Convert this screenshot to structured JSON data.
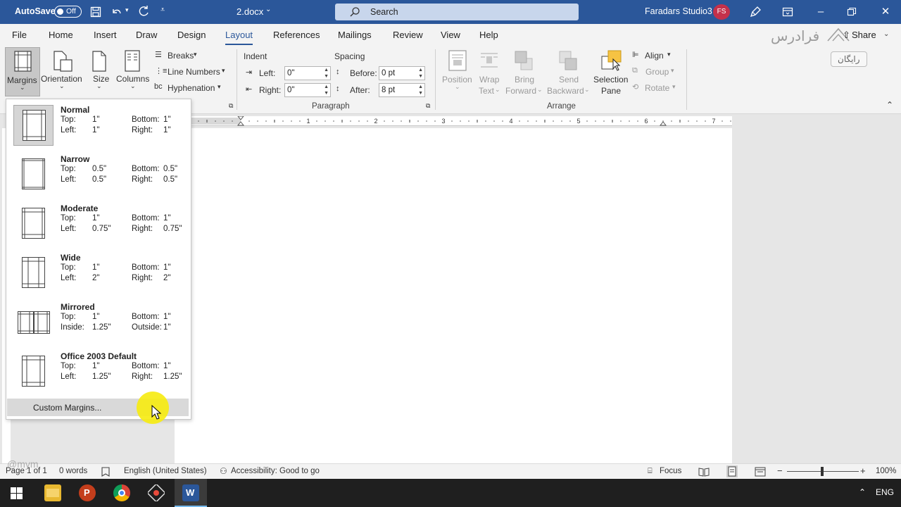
{
  "titlebar": {
    "autosave_label": "AutoSave",
    "autosave_state": "Off",
    "doc_name": "2.docx",
    "search_placeholder": "Search",
    "user_name": "Faradars Studio3",
    "user_initials": "FS",
    "brand_color": "#2b579a"
  },
  "tabs": [
    "File",
    "Home",
    "Insert",
    "Draw",
    "Design",
    "Layout",
    "References",
    "Mailings",
    "Review",
    "View",
    "Help"
  ],
  "active_tab": "Layout",
  "share_label": "Share",
  "watermark": {
    "logo_text": "فرادرس",
    "badge_text": "رایگان",
    "corner_text": "@mym"
  },
  "ribbon": {
    "page_setup": {
      "margins": "Margins",
      "orientation": "Orientation",
      "size": "Size",
      "columns": "Columns",
      "breaks": "Breaks",
      "line_numbers": "Line Numbers",
      "hyphenation": "Hyphenation"
    },
    "paragraph": {
      "group_label": "Paragraph",
      "indent_label": "Indent",
      "spacing_label": "Spacing",
      "left_label": "Left:",
      "left_value": "0\"",
      "right_label": "Right:",
      "right_value": "0\"",
      "before_label": "Before:",
      "before_value": "0 pt",
      "after_label": "After:",
      "after_value": "8 pt"
    },
    "arrange": {
      "group_label": "Arrange",
      "position": "Position",
      "wrap1": "Wrap",
      "wrap2": "Text",
      "bring1": "Bring",
      "bring2": "Forward",
      "send1": "Send",
      "send2": "Backward",
      "selection1": "Selection",
      "selection2": "Pane",
      "align": "Align",
      "group": "Group",
      "rotate": "Rotate"
    }
  },
  "ruler_numbers": [
    "1",
    "2",
    "3",
    "4",
    "5",
    "6",
    "7"
  ],
  "margins_menu": {
    "options": [
      {
        "name": "Normal",
        "a_label": "Top:",
        "a_value": "1\"",
        "b_label": "Bottom:",
        "b_value": "1\"",
        "c_label": "Left:",
        "c_value": "1\"",
        "d_label": "Right:",
        "d_value": "1\"",
        "selected": true
      },
      {
        "name": "Narrow",
        "a_label": "Top:",
        "a_value": "0.5\"",
        "b_label": "Bottom:",
        "b_value": "0.5\"",
        "c_label": "Left:",
        "c_value": "0.5\"",
        "d_label": "Right:",
        "d_value": "0.5\"",
        "selected": false
      },
      {
        "name": "Moderate",
        "a_label": "Top:",
        "a_value": "1\"",
        "b_label": "Bottom:",
        "b_value": "1\"",
        "c_label": "Left:",
        "c_value": "0.75\"",
        "d_label": "Right:",
        "d_value": "0.75\"",
        "selected": false
      },
      {
        "name": "Wide",
        "a_label": "Top:",
        "a_value": "1\"",
        "b_label": "Bottom:",
        "b_value": "1\"",
        "c_label": "Left:",
        "c_value": "2\"",
        "d_label": "Right:",
        "d_value": "2\"",
        "selected": false
      },
      {
        "name": "Mirrored",
        "a_label": "Top:",
        "a_value": "1\"",
        "b_label": "Bottom:",
        "b_value": "1\"",
        "c_label": "Inside:",
        "c_value": "1.25\"",
        "d_label": "Outside:",
        "d_value": "1\"",
        "selected": false
      },
      {
        "name": "Office 2003 Default",
        "a_label": "Top:",
        "a_value": "1\"",
        "b_label": "Bottom:",
        "b_value": "1\"",
        "c_label": "Left:",
        "c_value": "1.25\"",
        "d_label": "Right:",
        "d_value": "1.25\"",
        "selected": false
      }
    ],
    "custom_label": "Custom Margins..."
  },
  "statusbar": {
    "page": "Page 1 of 1",
    "words": "0 words",
    "language": "English (United States)",
    "accessibility": "Accessibility: Good to go",
    "focus": "Focus",
    "zoom": "100%"
  },
  "taskbar": {
    "lang": "ENG"
  }
}
